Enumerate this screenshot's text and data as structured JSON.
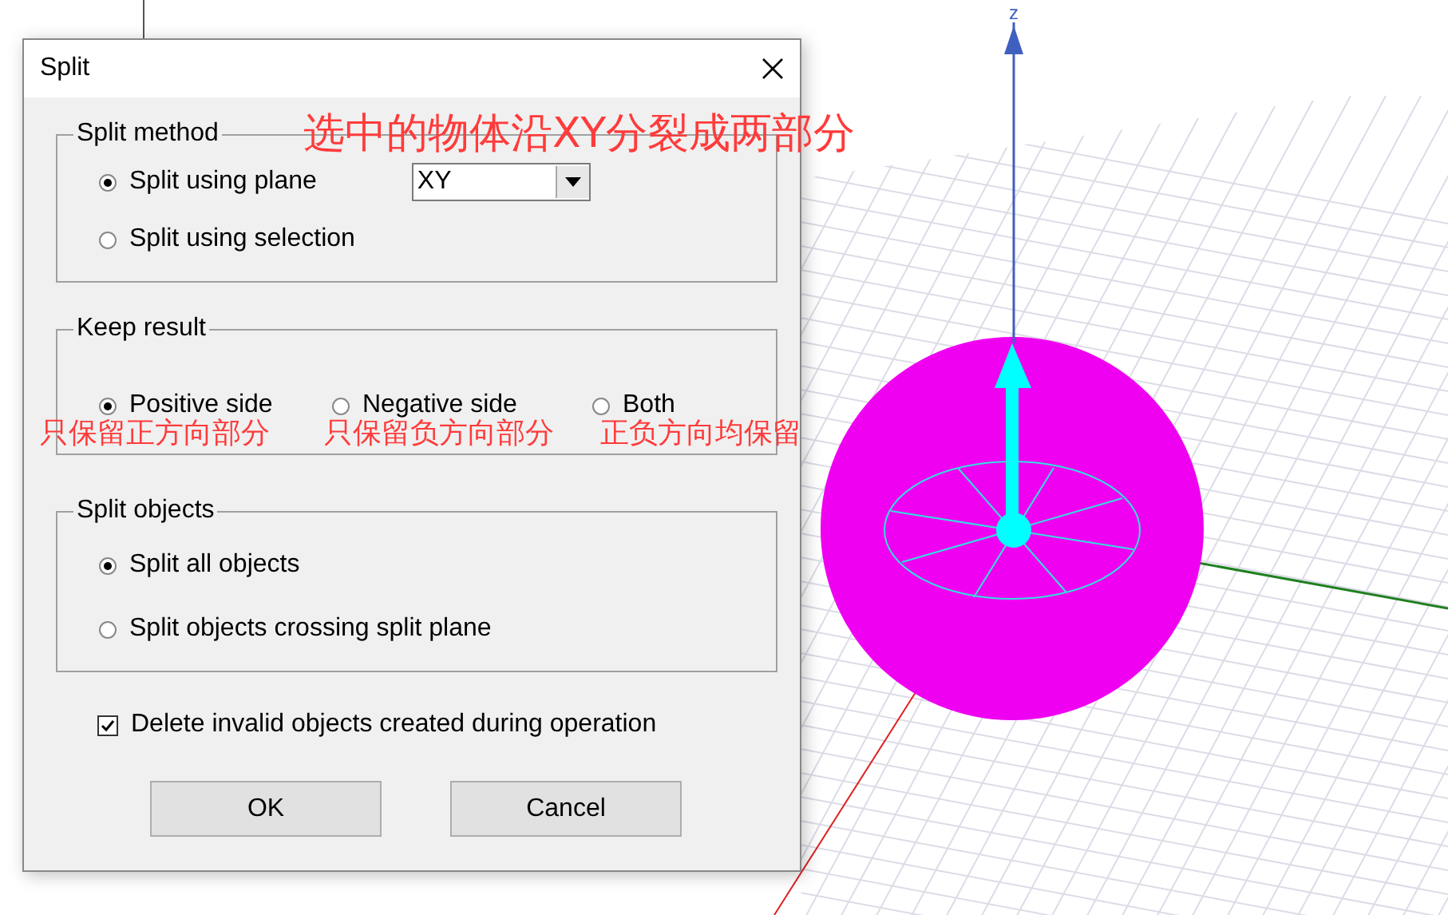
{
  "viewport": {
    "axis_label": "z"
  },
  "dialog": {
    "title": "Split",
    "split_method": {
      "title": "Split method",
      "options": [
        {
          "label": "Split using plane",
          "selected": true
        },
        {
          "label": "Split using selection",
          "selected": false
        }
      ],
      "plane_dropdown": {
        "value": "XY"
      }
    },
    "keep_result": {
      "title": "Keep result",
      "options": [
        {
          "label": "Positive side",
          "selected": true
        },
        {
          "label": "Negative side",
          "selected": false
        },
        {
          "label": "Both",
          "selected": false
        }
      ]
    },
    "split_objects": {
      "title": "Split objects",
      "options": [
        {
          "label": "Split all objects",
          "selected": true
        },
        {
          "label": "Split objects crossing split plane",
          "selected": false
        }
      ]
    },
    "delete_invalid": {
      "label": "Delete invalid objects created during operation",
      "checked": true
    },
    "buttons": [
      "OK",
      "Cancel"
    ]
  },
  "annotations": [
    {
      "text": "选中的物体沿XY分裂成两部分"
    },
    {
      "text": "只保留正方向部分"
    },
    {
      "text": "只保留负方向部分"
    },
    {
      "text": "正负方向均保留"
    }
  ]
}
